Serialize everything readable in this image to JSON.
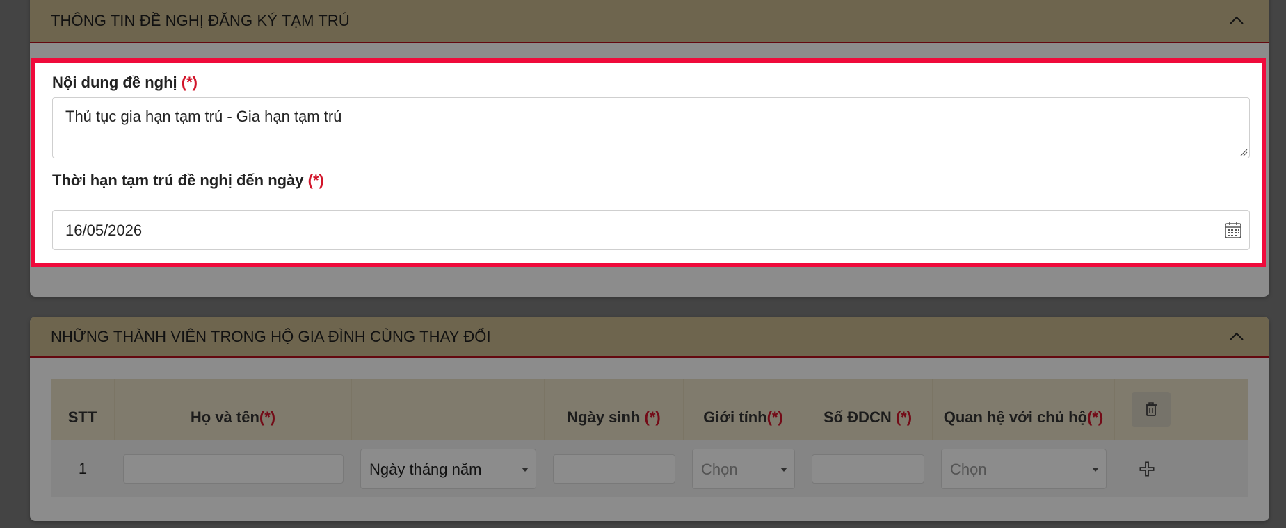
{
  "section1": {
    "title": "THÔNG TIN ĐỀ NGHỊ ĐĂNG KÝ TẠM TRÚ",
    "content_label": "Nội dung đề nghị",
    "required_mark": "(*)",
    "content_value": "Thủ tục gia hạn tạm trú - Gia hạn tạm trú",
    "date_label": "Thời hạn tạm trú đề nghị đến ngày",
    "date_value": "16/05/2026"
  },
  "section2": {
    "title": "NHỮNG THÀNH VIÊN TRONG HỘ GIA ĐÌNH CÙNG THAY ĐỔI",
    "columns": {
      "stt": "STT",
      "name": "Họ và tên",
      "name_req": "(*)",
      "dob": "Ngày sinh",
      "dob_req": "(*)",
      "gender": "Giới tính",
      "gender_req": "(*)",
      "id": "Số ĐDCN",
      "id_req": "(*)",
      "relation": "Quan hệ với chủ hộ",
      "relation_req": "(*)"
    },
    "row": {
      "stt": "1",
      "date_format": "Ngày tháng năm",
      "gender_placeholder": "Chọn",
      "relation_placeholder": "Chọn"
    }
  },
  "colors": {
    "highlight": "#ef0a3b",
    "header_bg": "#c9b98f",
    "required": "#d2152a"
  },
  "icons": [
    "chevron-up-icon",
    "calendar-icon",
    "trash-icon",
    "plus-icon",
    "dropdown-caret-icon",
    "resize-handle-icon"
  ]
}
